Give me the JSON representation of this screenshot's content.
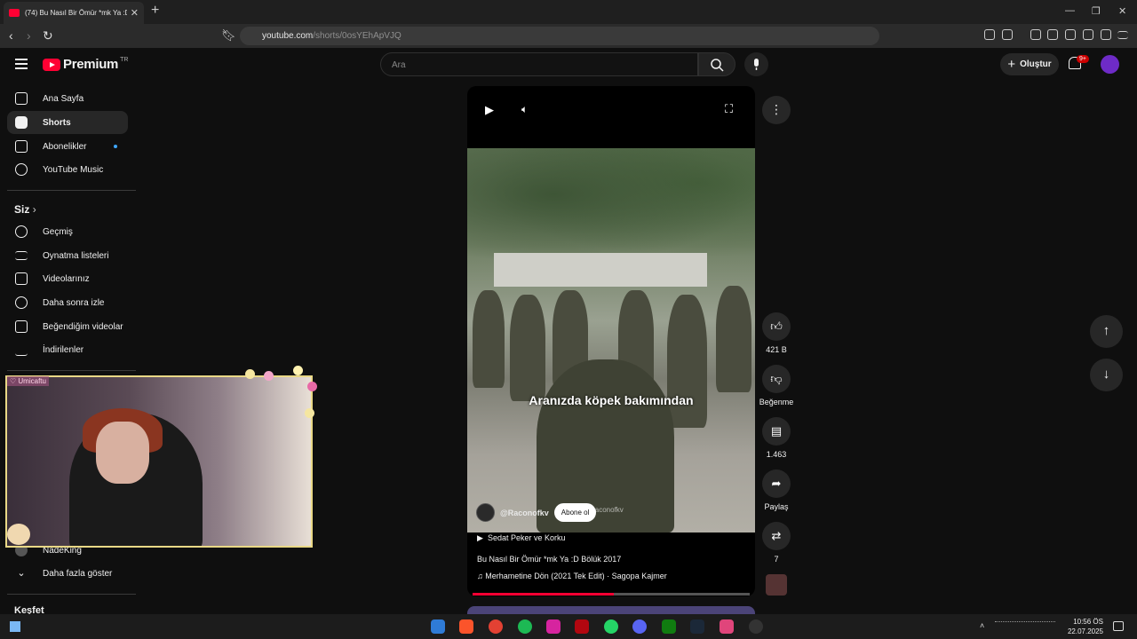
{
  "browser": {
    "tab_title": "(74) Bu Nasıl Bir Ömür *mk Ya :D",
    "url_host": "youtube.com",
    "url_path": "/shorts/0osYEhApVJQ"
  },
  "header": {
    "logo_text": "Premium",
    "country": "TR",
    "search_placeholder": "Ara",
    "create_label": "Oluştur",
    "notif_count": "9+"
  },
  "sidebar": {
    "items": [
      {
        "label": "Ana Sayfa"
      },
      {
        "label": "Shorts"
      },
      {
        "label": "Abonelikler"
      },
      {
        "label": "YouTube Music"
      }
    ],
    "siz_title": "Siz",
    "siz_items": [
      {
        "label": "Geçmiş"
      },
      {
        "label": "Oynatma listeleri"
      },
      {
        "label": "Videolarınız"
      },
      {
        "label": "Daha sonra izle"
      },
      {
        "label": "Beğendiğim videolar"
      },
      {
        "label": "İndirilenler"
      }
    ],
    "channel_item": "NadeKing",
    "show_more": "Daha fazla göster",
    "explore_title": "Keşfet"
  },
  "short": {
    "caption": "Aranızda köpek bakımından",
    "watermark": "Raconofkv",
    "channel": "@Raconofkv",
    "subscribe": "Abone ol",
    "playlist": "Sedat Peker ve Korku",
    "title": "Bu Nasıl Bir Ömür *mk Ya :D Bölük 2017",
    "music": "Merhametine Dön (2021 Tek Edit) · Sagopa Kajmer",
    "progress": 0.51
  },
  "actions": {
    "likes": "421 B",
    "dislike": "Beğenme",
    "comments": "1.463",
    "share": "Paylaş",
    "remix": "7"
  },
  "overlay": {
    "tag": "♡ Umicaftu"
  },
  "taskbar": {
    "time": "10:56 ÖS",
    "date": "22.07.2025"
  },
  "colors": {
    "accent_red": "#ff0033",
    "bg": "#0f0f0f"
  }
}
